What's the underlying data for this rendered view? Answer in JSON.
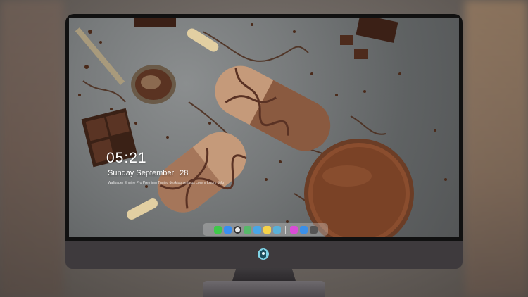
{
  "lockscreen": {
    "time": "05:21",
    "date_weekday_month": "Sunday September",
    "date_day": "28",
    "notice_text": "Wallpaper Engine Pro Premium Tuning desktop settings Lorem Ipsum dolor sit amet"
  },
  "dock": {
    "apps": [
      {
        "name": "messages-icon",
        "color": "#3fc84a"
      },
      {
        "name": "finder-icon",
        "color": "#3a8ef0"
      },
      {
        "name": "clock-icon",
        "color": "#e8e8e8"
      },
      {
        "name": "maps-icon",
        "color": "#57b86a"
      },
      {
        "name": "videos-icon",
        "color": "#4aa6e6"
      },
      {
        "name": "notes-icon",
        "color": "#f5d24a"
      },
      {
        "name": "photos-icon",
        "color": "#5ab0d8"
      },
      {
        "name": "music-icon",
        "color": "#d94dd6"
      },
      {
        "name": "appstore-icon",
        "color": "#3b8fe8"
      },
      {
        "name": "system-icon",
        "color": "#555555"
      }
    ]
  }
}
